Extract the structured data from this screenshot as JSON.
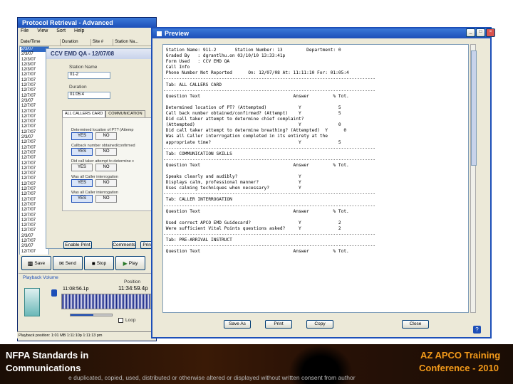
{
  "app": {
    "title": "Protocol Retrieval - Advanced",
    "menu": [
      "File",
      "View",
      "Sort",
      "Help"
    ],
    "list_headers": [
      "Date/Time",
      "Duration",
      "Site #",
      "Station Na..."
    ],
    "list_rows": [
      "2/3/07",
      "2/3/07",
      "12/3/07",
      "12/3/07",
      "12/3/07",
      "12/7/07",
      "12/7/07",
      "12/7/07",
      "12/7/07",
      "12/7/07",
      "2/3/07",
      "12/7/07",
      "12/7/07",
      "12/7/07",
      "12/7/07",
      "12/7/07",
      "12/7/07",
      "2/3/07",
      "12/7/07",
      "12/7/07",
      "12/7/07",
      "12/7/07",
      "12/7/07",
      "12/7/07",
      "12/7/07",
      "12/7/07",
      "12/7/07",
      "12/7/07",
      "12/7/07",
      "12/7/07",
      "12/7/07",
      "12/7/07",
      "12/7/07",
      "12/7/07",
      "12/7/07",
      "12/7/07",
      "2/3/07",
      "12/7/07",
      "2/3/07",
      "12/7/07"
    ]
  },
  "qa_panel": {
    "title": "CCV EMD QA - 12/07/08",
    "station_name_label": "Station Name",
    "station_name_value": "01-2",
    "duration_label": "Duration",
    "duration_value": "01:05:4",
    "tabs": [
      "ALL CALLERS CARD",
      "COMMUNICATION"
    ],
    "questions": [
      "Determined location of PT? (Attemp",
      "Callback number obtained/confirmed",
      "Did call taker attempt to determine c",
      "Was all Caller interrogation",
      "Was all Caller interrogation"
    ],
    "yes": "YES",
    "no": "NO",
    "enable_print": "Enable Print",
    "comments": "Comments",
    "print": "Print"
  },
  "player": {
    "save": "Save",
    "send": "Send",
    "stop": "Stop",
    "play": "Play",
    "playback_label": "Playback Volume",
    "position_label": "Position",
    "start_time": "11:08:56.1p",
    "end_time": "11:34:59.4p",
    "loop": "Loop",
    "volume_fraction": 0.55
  },
  "status_bar": "Playback position: 1:01 MB 1:11:10p 1:11:13 pm",
  "preview": {
    "title": "Preview",
    "lines": [
      " Station Name: 911-2       Station Number: 13         Department: 0",
      " Graded By   : dgrantlhu.on 03/10/10 13:33:41p",
      " Form Used   : CCV EMD QA",
      " Call Info",
      " Phone Number Not Reported      On: 12/07/08 At: 11:11:10 For: 01:05:4",
      "--------------------------------------------------------------------------------",
      " Tab: ALL CALLERS CARD",
      "--------------------------------------------------------------------------------",
      " Question Text                                   Answer         % Tot.",
      "",
      " Determined location of PT? (Attempted)            Y              5",
      " Call back number obtained/confirmed? (Attempt)    Y              5",
      " Did call taker attempt to determine chief complaint?",
      " (Attempted)                                       Y              0",
      " Did call taker attempt to determine breathing? (Attempted)  Y      0",
      " Was all Caller interrogation completed in its entirety at the",
      " appropriate time?                                 Y              5",
      "--------------------------------------------------------------------------------",
      " Tab: COMMUNICATION SKILLS",
      "--------------------------------------------------------------------------------",
      " Question Text                                   Answer         % Tot.",
      "",
      " Speaks clearly and audibly?                       Y",
      " Displays calm, professional manner?               Y",
      " Uses calming techniques when necessary?           Y",
      "--------------------------------------------------------------------------------",
      " Tab: CALLER INTERROGATION",
      "--------------------------------------------------------------------------------",
      " Question Text                                   Answer         % Tot.",
      "",
      " Used correct APCO EMD Guidecard?                  Y              2",
      " Were sufficient Vital Points questions asked?     Y              2",
      "--------------------------------------------------------------------------------",
      " Tab: PRE-ARRIVAL INSTRUCT",
      "--------------------------------------------------------------------------------",
      " Question Text                                   Answer         % Tot."
    ],
    "buttons": [
      "Save As",
      "Print",
      "Copy",
      "Close"
    ]
  },
  "footer": {
    "left_line1": "NFPA Standards in",
    "left_line2": "Communications",
    "right_line1": "AZ APCO Training",
    "right_line2": "Conference - 2010",
    "copyright": "e duplicated, copied, used, distributed or otherwise altered or displayed without written consent from author"
  },
  "colors": {
    "xp_title": "#1d4fb8",
    "window_bg": "#ece9d8",
    "footer_text": "#f39a1a",
    "waveform": "#1a2a8a"
  }
}
